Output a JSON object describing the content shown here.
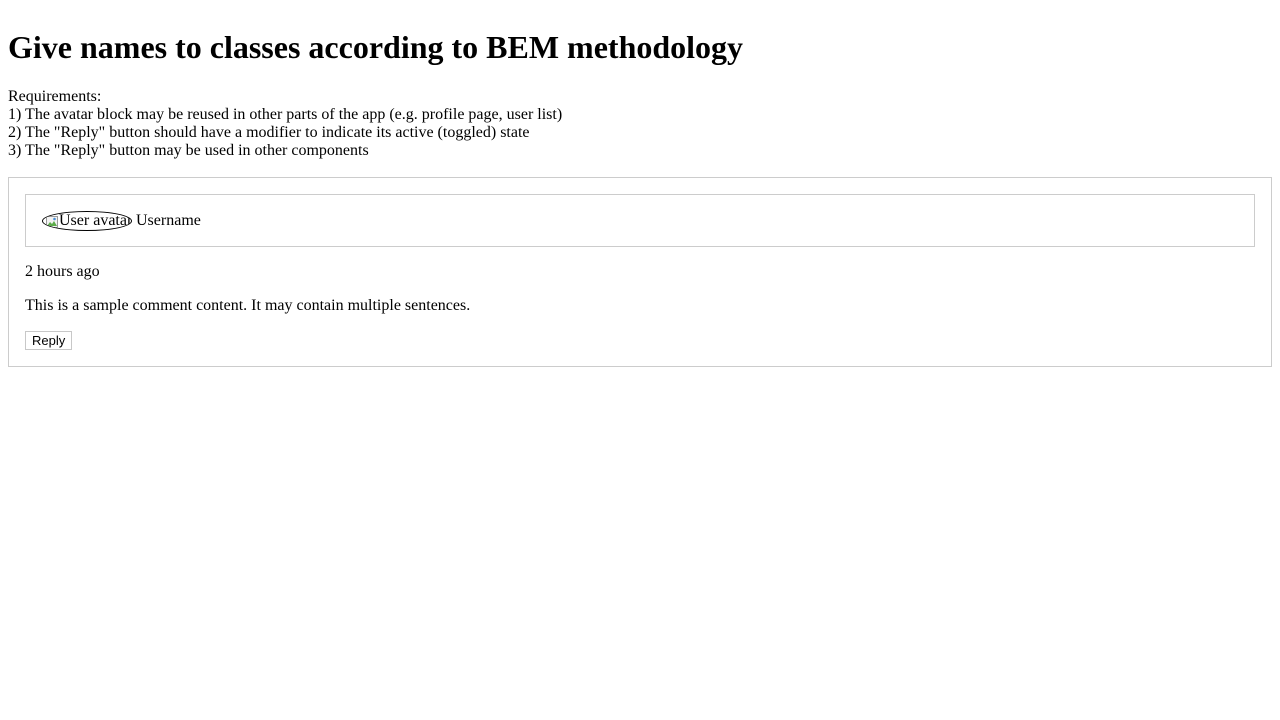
{
  "page": {
    "title": "Give names to classes according to BEM methodology",
    "requirements_heading": "Requirements:",
    "requirements": [
      "1) The avatar block may be reused in other parts of the app (e.g. profile page, user list)",
      "2) The \"Reply\" button should have a modifier to indicate its active (toggled) state",
      "3) The \"Reply\" button may be used in other components"
    ]
  },
  "comment": {
    "avatar_alt": "User avatar",
    "username": "Username",
    "time": "2 hours ago",
    "text": "This is a sample comment content. It may contain multiple sentences.",
    "reply_label": "Reply"
  },
  "icons": {
    "broken_image": "broken-image-icon"
  }
}
